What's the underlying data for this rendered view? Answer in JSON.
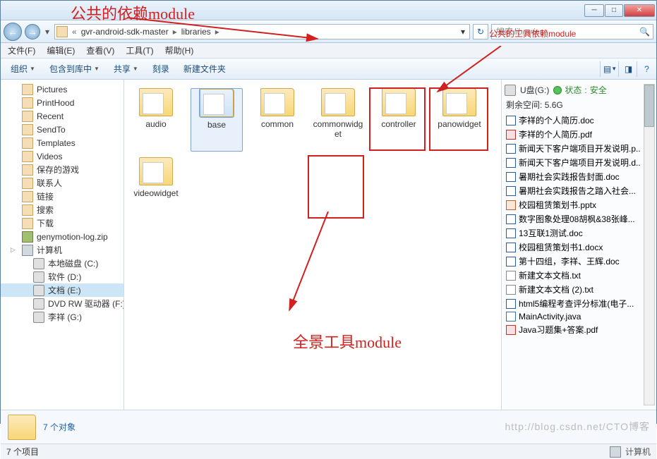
{
  "annotations": {
    "top_left": "公共的依赖module",
    "top_right": "公共的工具依赖module",
    "center": "全景工具module"
  },
  "titlebar": {
    "minimize": "─",
    "maximize": "□",
    "close": "✕"
  },
  "navbar": {
    "back": "←",
    "forward": "→",
    "breadcrumb": {
      "seg1": "gvr-android-sdk-master",
      "seg2": "libraries"
    },
    "refresh": "↻",
    "search_placeholder": "搜索 libraries"
  },
  "menubar": {
    "file": "文件(F)",
    "edit": "编辑(E)",
    "view": "查看(V)",
    "tools": "工具(T)",
    "help": "帮助(H)"
  },
  "toolbar": {
    "organize": "组织",
    "include": "包含到库中",
    "share": "共享",
    "burn": "刻录",
    "newfolder": "新建文件夹"
  },
  "tree": {
    "items": [
      {
        "label": "Pictures",
        "icon": "folder"
      },
      {
        "label": "PrintHood",
        "icon": "folder"
      },
      {
        "label": "Recent",
        "icon": "folder"
      },
      {
        "label": "SendTo",
        "icon": "folder"
      },
      {
        "label": "Templates",
        "icon": "folder"
      },
      {
        "label": "Videos",
        "icon": "folder"
      },
      {
        "label": "保存的游戏",
        "icon": "folder"
      },
      {
        "label": "联系人",
        "icon": "folder"
      },
      {
        "label": "链接",
        "icon": "folder"
      },
      {
        "label": "搜索",
        "icon": "folder"
      },
      {
        "label": "下载",
        "icon": "folder"
      },
      {
        "label": "genymotion-log.zip",
        "icon": "zip"
      },
      {
        "label": "计算机",
        "icon": "pc",
        "expand": true
      },
      {
        "label": "本地磁盘 (C:)",
        "icon": "drv",
        "lvl": 1
      },
      {
        "label": "软件 (D:)",
        "icon": "drv",
        "lvl": 1
      },
      {
        "label": "文档 (E:)",
        "icon": "drv",
        "lvl": 1,
        "sel": true
      },
      {
        "label": "DVD RW 驱动器 (F:)",
        "icon": "drv",
        "lvl": 1
      },
      {
        "label": "李祥 (G:)",
        "icon": "drv",
        "lvl": 1
      }
    ]
  },
  "main": {
    "folders": [
      {
        "label": "audio"
      },
      {
        "label": "base",
        "sel": true
      },
      {
        "label": "common"
      },
      {
        "label": "commonwidget"
      },
      {
        "label": "controller"
      },
      {
        "label": "panowidget"
      },
      {
        "label": "videowidget"
      }
    ]
  },
  "preview": {
    "drive_label": "U盘(G:)",
    "status_prefix": "状态",
    "status_value": "安全",
    "free_space_label": "剩余空间:",
    "free_space_value": "5.6G",
    "files": [
      {
        "label": "李祥的个人简历.doc",
        "icon": "doc"
      },
      {
        "label": "李祥的个人简历.pdf",
        "icon": "pdf"
      },
      {
        "label": "新闻天下客户端项目开发说明.p..",
        "icon": "doc"
      },
      {
        "label": "新闻天下客户端项目开发说明.d..",
        "icon": "doc"
      },
      {
        "label": "暑期社会实践报告封面.doc",
        "icon": "doc"
      },
      {
        "label": "暑期社会实践报告之踏入社会...",
        "icon": "doc"
      },
      {
        "label": "校园租赁策划书.pptx",
        "icon": "ppt"
      },
      {
        "label": "数字图象处理08胡枫&38张峰...",
        "icon": "doc"
      },
      {
        "label": "13互联1测试.doc",
        "icon": "doc"
      },
      {
        "label": "校园租赁策划书1.docx",
        "icon": "doc"
      },
      {
        "label": "第十四组，李祥、王辉.doc",
        "icon": "doc"
      },
      {
        "label": "新建文本文档.txt",
        "icon": "txt"
      },
      {
        "label": "新建文本文档 (2).txt",
        "icon": "txt"
      },
      {
        "label": "html5编程考查评分标准(电子...",
        "icon": "doc"
      },
      {
        "label": "MainActivity.java",
        "icon": "java"
      },
      {
        "label": "Java习题集+答案.pdf",
        "icon": "pdf"
      }
    ]
  },
  "details": {
    "count_text": "7 个对象"
  },
  "statusbar": {
    "left": "7 个项目",
    "right": "计算机"
  },
  "watermark": "http://blog.csdn.net/CTO博客"
}
